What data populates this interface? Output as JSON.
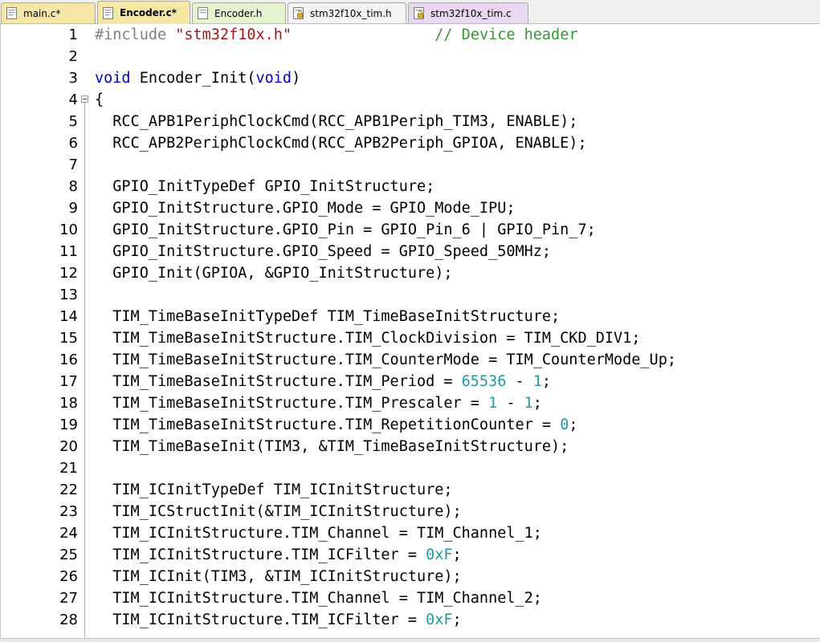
{
  "tabs": [
    {
      "label": "main.c*",
      "icon": "c-source-file-icon",
      "color": "#f7e7a6",
      "active": false
    },
    {
      "label": "Encoder.c*",
      "icon": "c-source-file-icon",
      "color": "#f7e7a6",
      "active": true
    },
    {
      "label": "Encoder.h",
      "icon": "header-file-icon",
      "color": "#e4f4cf",
      "active": false
    },
    {
      "label": "stm32f10x_tim.h",
      "icon": "locked-file-icon",
      "color": "#f4f4f4",
      "active": false
    },
    {
      "label": "stm32f10x_tim.c",
      "icon": "locked-file-icon",
      "color": "#ead7f2",
      "active": false
    }
  ],
  "code": {
    "lines": [
      {
        "number": "1",
        "fold": false,
        "tokens": [
          {
            "t": "#include ",
            "c": "pp"
          },
          {
            "t": "\"stm32f10x.h\"",
            "c": "str"
          },
          {
            "t": "                ",
            "c": ""
          },
          {
            "t": "// Device header",
            "c": "cmt"
          }
        ]
      },
      {
        "number": "2",
        "fold": false,
        "tokens": []
      },
      {
        "number": "3",
        "fold": false,
        "tokens": [
          {
            "t": "void",
            "c": "kw"
          },
          {
            "t": " Encoder_Init(",
            "c": ""
          },
          {
            "t": "void",
            "c": "kw"
          },
          {
            "t": ")",
            "c": ""
          }
        ]
      },
      {
        "number": "4",
        "fold": true,
        "tokens": [
          {
            "t": "{",
            "c": ""
          }
        ]
      },
      {
        "number": "5",
        "fold": false,
        "tokens": [
          {
            "t": "  RCC_APB1PeriphClockCmd(RCC_APB1Periph_TIM3, ENABLE);",
            "c": ""
          }
        ]
      },
      {
        "number": "6",
        "fold": false,
        "tokens": [
          {
            "t": "  RCC_APB2PeriphClockCmd(RCC_APB2Periph_GPIOA, ENABLE);",
            "c": ""
          }
        ]
      },
      {
        "number": "7",
        "fold": false,
        "tokens": []
      },
      {
        "number": "8",
        "fold": false,
        "tokens": [
          {
            "t": "  GPIO_InitTypeDef GPIO_InitStructure;",
            "c": ""
          }
        ]
      },
      {
        "number": "9",
        "fold": false,
        "tokens": [
          {
            "t": "  GPIO_InitStructure.GPIO_Mode = GPIO_Mode_IPU;",
            "c": ""
          }
        ]
      },
      {
        "number": "10",
        "fold": false,
        "tokens": [
          {
            "t": "  GPIO_InitStructure.GPIO_Pin = GPIO_Pin_6 | GPIO_Pin_7;",
            "c": ""
          }
        ]
      },
      {
        "number": "11",
        "fold": false,
        "tokens": [
          {
            "t": "  GPIO_InitStructure.GPIO_Speed = GPIO_Speed_50MHz;",
            "c": ""
          }
        ]
      },
      {
        "number": "12",
        "fold": false,
        "tokens": [
          {
            "t": "  GPIO_Init(GPIOA, &GPIO_InitStructure);",
            "c": ""
          }
        ]
      },
      {
        "number": "13",
        "fold": false,
        "tokens": []
      },
      {
        "number": "14",
        "fold": false,
        "tokens": [
          {
            "t": "  TIM_TimeBaseInitTypeDef TIM_TimeBaseInitStructure;",
            "c": ""
          }
        ]
      },
      {
        "number": "15",
        "fold": false,
        "tokens": [
          {
            "t": "  TIM_TimeBaseInitStructure.TIM_ClockDivision = TIM_CKD_DIV1;",
            "c": ""
          }
        ]
      },
      {
        "number": "16",
        "fold": false,
        "tokens": [
          {
            "t": "  TIM_TimeBaseInitStructure.TIM_CounterMode = TIM_CounterMode_Up;",
            "c": ""
          }
        ]
      },
      {
        "number": "17",
        "fold": false,
        "tokens": [
          {
            "t": "  TIM_TimeBaseInitStructure.TIM_Period = ",
            "c": ""
          },
          {
            "t": "65536",
            "c": "num"
          },
          {
            "t": " - ",
            "c": ""
          },
          {
            "t": "1",
            "c": "num"
          },
          {
            "t": ";",
            "c": ""
          }
        ]
      },
      {
        "number": "18",
        "fold": false,
        "tokens": [
          {
            "t": "  TIM_TimeBaseInitStructure.TIM_Prescaler = ",
            "c": ""
          },
          {
            "t": "1",
            "c": "num"
          },
          {
            "t": " - ",
            "c": ""
          },
          {
            "t": "1",
            "c": "num"
          },
          {
            "t": ";",
            "c": ""
          }
        ]
      },
      {
        "number": "19",
        "fold": false,
        "tokens": [
          {
            "t": "  TIM_TimeBaseInitStructure.TIM_RepetitionCounter = ",
            "c": ""
          },
          {
            "t": "0",
            "c": "num"
          },
          {
            "t": ";",
            "c": ""
          }
        ]
      },
      {
        "number": "20",
        "fold": false,
        "tokens": [
          {
            "t": "  TIM_TimeBaseInit(TIM3, &TIM_TimeBaseInitStructure);",
            "c": ""
          }
        ]
      },
      {
        "number": "21",
        "fold": false,
        "tokens": []
      },
      {
        "number": "22",
        "fold": false,
        "tokens": [
          {
            "t": "  TIM_ICInitTypeDef TIM_ICInitStructure;",
            "c": ""
          }
        ]
      },
      {
        "number": "23",
        "fold": false,
        "tokens": [
          {
            "t": "  TIM_ICStructInit(&TIM_ICInitStructure);",
            "c": ""
          }
        ]
      },
      {
        "number": "24",
        "fold": false,
        "tokens": [
          {
            "t": "  TIM_ICInitStructure.TIM_Channel = TIM_Channel_1;",
            "c": ""
          }
        ]
      },
      {
        "number": "25",
        "fold": false,
        "tokens": [
          {
            "t": "  TIM_ICInitStructure.TIM_ICFilter = ",
            "c": ""
          },
          {
            "t": "0xF",
            "c": "num"
          },
          {
            "t": ";",
            "c": ""
          }
        ]
      },
      {
        "number": "26",
        "fold": false,
        "tokens": [
          {
            "t": "  TIM_ICInit(TIM3, &TIM_ICInitStructure);",
            "c": ""
          }
        ]
      },
      {
        "number": "27",
        "fold": false,
        "tokens": [
          {
            "t": "  TIM_ICInitStructure.TIM_Channel = TIM_Channel_2;",
            "c": ""
          }
        ]
      },
      {
        "number": "28",
        "fold": false,
        "tokens": [
          {
            "t": "  TIM_ICInitStructure.TIM_ICFilter = ",
            "c": ""
          },
          {
            "t": "0xF",
            "c": "num"
          },
          {
            "t": ";",
            "c": ""
          }
        ]
      }
    ]
  }
}
